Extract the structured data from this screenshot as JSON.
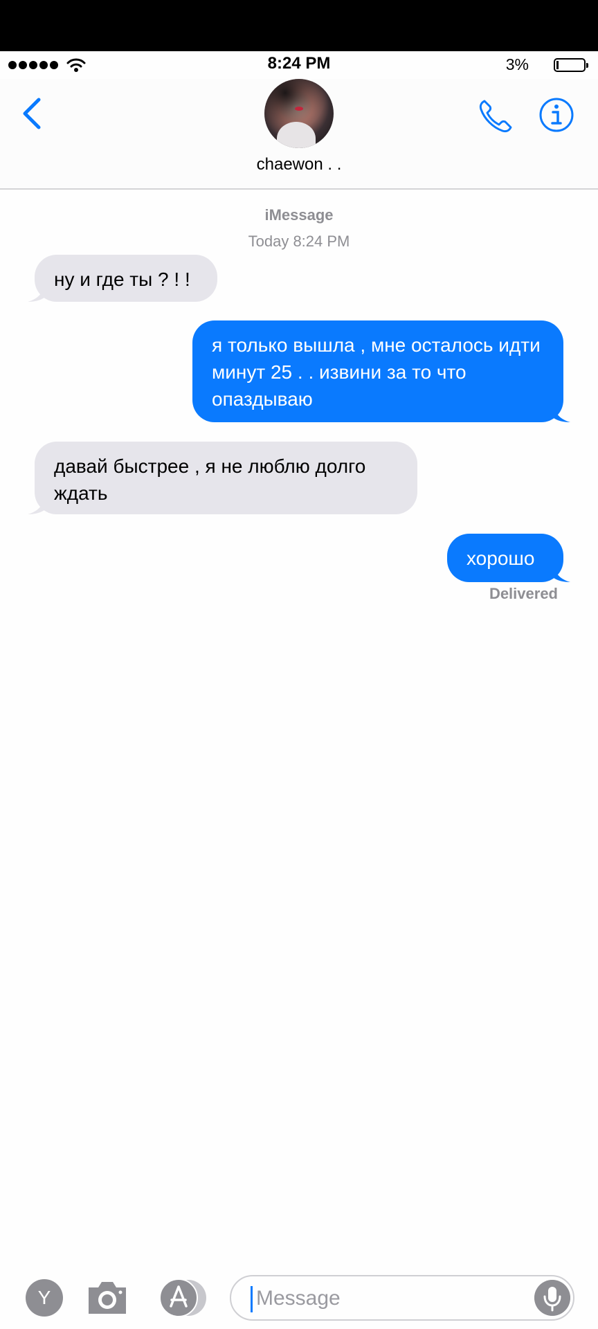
{
  "status_bar": {
    "time": "8:24 PM",
    "battery_percent": "3%",
    "battery_level": 0.03,
    "signal_dots": 5
  },
  "header": {
    "contact_name": "chaewon . .",
    "back_icon": "chevron-left-icon",
    "call_icon": "phone-icon",
    "info_icon": "info-icon",
    "accent_color": "#0a7afe"
  },
  "thread": {
    "service": "iMessage",
    "timestamp": "Today 8:24 PM",
    "messages": [
      {
        "direction": "incoming",
        "text": "ну и где ты ? ! !"
      },
      {
        "direction": "outgoing",
        "text": "я только вышла , мне осталось идти минут 25 . . извини за то что опаздываю"
      },
      {
        "direction": "incoming",
        "text": "давай быстрее , я не люблю долго ждать"
      },
      {
        "direction": "outgoing",
        "text": "хорошо"
      }
    ],
    "delivery_status": "Delivered",
    "incoming_color": "#e6e5eb",
    "outgoing_color": "#0a7afe"
  },
  "composer": {
    "app_button_label": "Y",
    "camera_icon": "camera-icon",
    "appstore_icon": "app-store-icon",
    "placeholder": "Message",
    "mic_icon": "microphone-icon"
  }
}
